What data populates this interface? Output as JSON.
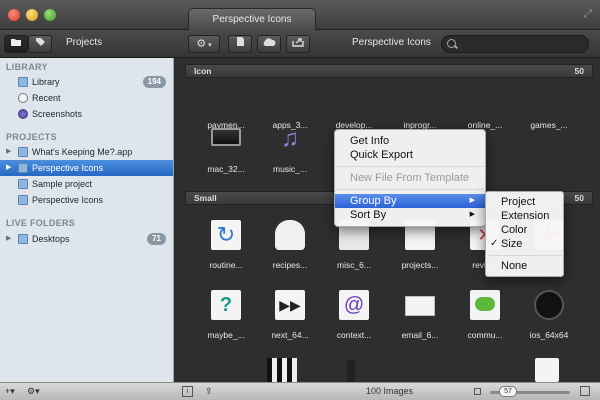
{
  "window": {
    "tab_title": "Perspective Icons"
  },
  "toolbar": {
    "projects_label": "Projects",
    "title": "Perspective Icons",
    "search_placeholder": ""
  },
  "sidebar": {
    "library_heading": "LIBRARY",
    "library_items": [
      {
        "label": "Library",
        "badge": "194"
      },
      {
        "label": "Recent"
      },
      {
        "label": "Screenshots"
      }
    ],
    "projects_heading": "PROJECTS",
    "project_items": [
      {
        "label": "What's Keeping Me?.app"
      },
      {
        "label": "Perspective Icons"
      },
      {
        "label": "Sample project"
      },
      {
        "label": "Perspective Icons"
      }
    ],
    "live_heading": "LIVE FOLDERS",
    "live_items": [
      {
        "label": "Desktops",
        "badge": "71"
      }
    ]
  },
  "sections": [
    {
      "title": "Icon",
      "count": "50",
      "items": [
        "paymen...",
        "apps_3...",
        "develop...",
        "inprogr...",
        "online_...",
        "games_...",
        "mac_32...",
        "music_..."
      ]
    },
    {
      "title": "Small",
      "count": "50",
      "items": [
        "routine...",
        "recipes...",
        "misc_6...",
        "projects...",
        "revie...",
        "",
        "maybe_...",
        "next_64...",
        "context...",
        "email_6...",
        "commu...",
        "ios_64x64"
      ]
    }
  ],
  "context_menu": {
    "items": [
      "Get Info",
      "Quick Export",
      "New File From Template",
      "Group By",
      "Sort By"
    ],
    "submenu": [
      "Project",
      "Extension",
      "Color",
      "Size",
      "None"
    ],
    "checked": "Size"
  },
  "bottom": {
    "count_label": "100 Images",
    "zoom_value": "57"
  },
  "colors": {
    "selection": "#2668c3",
    "sidebar_bg": "#dfe5ec",
    "main_bg": "#2e2e2e"
  }
}
